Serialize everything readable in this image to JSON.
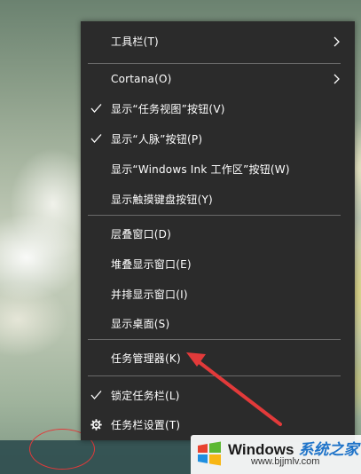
{
  "context_menu": {
    "items": [
      {
        "label": "工具栏(T)",
        "checked": false,
        "has_submenu": true
      },
      {
        "label": "Cortana(O)",
        "checked": false,
        "has_submenu": true
      },
      {
        "label": "显示“任务视图”按钮(V)",
        "checked": true,
        "has_submenu": false
      },
      {
        "label": "显示“人脉”按钮(P)",
        "checked": true,
        "has_submenu": false
      },
      {
        "label": "显示“Windows Ink 工作区”按钮(W)",
        "checked": false,
        "has_submenu": false
      },
      {
        "label": "显示触摸键盘按钮(Y)",
        "checked": false,
        "has_submenu": false
      },
      {
        "label": "层叠窗口(D)",
        "checked": false,
        "has_submenu": false
      },
      {
        "label": "堆叠显示窗口(E)",
        "checked": false,
        "has_submenu": false
      },
      {
        "label": "并排显示窗口(I)",
        "checked": false,
        "has_submenu": false
      },
      {
        "label": "显示桌面(S)",
        "checked": false,
        "has_submenu": false
      },
      {
        "label": "任务管理器(K)",
        "checked": false,
        "has_submenu": false
      },
      {
        "label": "锁定任务栏(L)",
        "checked": true,
        "has_submenu": false
      },
      {
        "label": "任务栏设置(T)",
        "checked": false,
        "has_submenu": false,
        "icon": "gear-icon"
      }
    ]
  },
  "watermark": {
    "title": "Windows",
    "title_accent": "系统之家",
    "url": "www.bjjmlv.com",
    "logo_icon": "windows-logo-icon"
  },
  "colors": {
    "menu_background": "#2b2b2b",
    "menu_text": "#ffffff",
    "separator": "#6a6a6a",
    "annotation_red": "#e23a3a",
    "taskbar": "#2c4b4e"
  }
}
